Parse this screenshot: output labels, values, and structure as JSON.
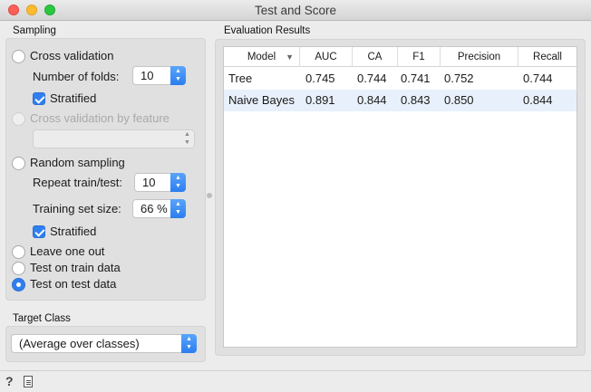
{
  "window": {
    "title": "Test and Score"
  },
  "sampling": {
    "section_title": "Sampling",
    "cross_validation": {
      "label": "Cross validation",
      "selected": false
    },
    "folds": {
      "label": "Number of folds:",
      "value": "10"
    },
    "cv_stratified": {
      "label": "Stratified",
      "checked": true
    },
    "cv_by_feature": {
      "label": "Cross validation by feature",
      "enabled": false,
      "value": ""
    },
    "random_sampling": {
      "label": "Random sampling",
      "selected": false
    },
    "repeat": {
      "label": "Repeat train/test:",
      "value": "10"
    },
    "train_size": {
      "label": "Training set size:",
      "value": "66 %"
    },
    "rs_stratified": {
      "label": "Stratified",
      "checked": true
    },
    "leave_one_out": {
      "label": "Leave one out",
      "selected": false
    },
    "train_data": {
      "label": "Test on train data",
      "selected": false
    },
    "test_data": {
      "label": "Test on test data",
      "selected": true
    }
  },
  "target": {
    "section_title": "Target Class",
    "value": "(Average over classes)"
  },
  "results": {
    "section_title": "Evaluation Results",
    "columns": [
      "Model",
      "AUC",
      "CA",
      "F1",
      "Precision",
      "Recall"
    ],
    "rows": [
      [
        "Tree",
        "0.745",
        "0.744",
        "0.741",
        "0.752",
        "0.744"
      ],
      [
        "Naive Bayes",
        "0.891",
        "0.844",
        "0.843",
        "0.850",
        "0.844"
      ]
    ]
  },
  "icons": {
    "help": "help-icon",
    "report": "report-icon"
  },
  "colors": {
    "accent": "#2f7ff0",
    "row_highlight": "#e8f0fb"
  }
}
